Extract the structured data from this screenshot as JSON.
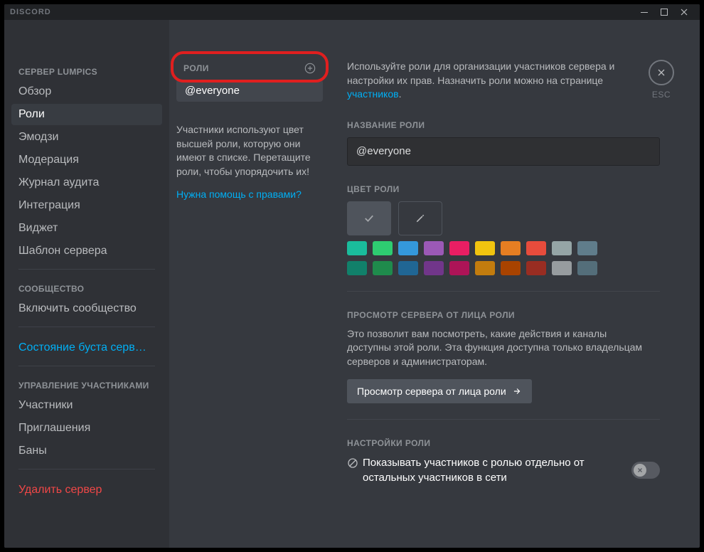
{
  "app": {
    "title": "DISCORD",
    "esc_label": "ESC"
  },
  "sidebar": {
    "server_header": "СЕРВЕР LUMPICS",
    "items": [
      "Обзор",
      "Роли",
      "Эмодзи",
      "Модерация",
      "Журнал аудита",
      "Интеграция",
      "Виджет",
      "Шаблон сервера"
    ],
    "community_header": "СООБЩЕСТВО",
    "community_items": [
      "Включить сообщество"
    ],
    "boost_item": "Состояние буста серв…",
    "user_mgmt_header": "УПРАВЛЕНИЕ УЧАСТНИКАМИ",
    "user_mgmt_items": [
      "Участники",
      "Приглашения",
      "Баны"
    ],
    "delete_server": "Удалить сервер"
  },
  "roles": {
    "header": "РОЛИ",
    "list": [
      "@everyone"
    ],
    "help_text": "Участники используют цвет высшей роли, которую они имеют в списке. Перетащите роли, чтобы упорядочить их!",
    "perm_help_link": "Нужна помощь с правами?"
  },
  "detail": {
    "desc_prefix": "Используйте роли для организации участников сервера и настройки их прав. Назначить роли можно на странице ",
    "desc_link": "участников",
    "name_label": "НАЗВАНИЕ РОЛИ",
    "name_value": "@everyone",
    "color_label": "ЦВЕТ РОЛИ",
    "swatches_row1": [
      "#1abc9c",
      "#2ecc71",
      "#3498db",
      "#9b59b6",
      "#e91e63",
      "#f1c40f",
      "#e67e22",
      "#e74c3c",
      "#95a5a6",
      "#607d8b"
    ],
    "swatches_row2": [
      "#11806a",
      "#1f8b4c",
      "#206694",
      "#71368a",
      "#ad1457",
      "#c27c0e",
      "#a84300",
      "#992d22",
      "#979c9f",
      "#546e7a"
    ],
    "preview_label": "ПРОСМОТР СЕРВЕРА ОТ ЛИЦА РОЛИ",
    "preview_desc": "Это позволит вам посмотреть, какие действия и каналы доступны этой роли. Эта функция доступна только владельцам серверов и администраторам.",
    "preview_button": "Просмотр сервера от лица роли",
    "settings_label": "НАСТРОЙКИ РОЛИ",
    "setting_display_separately": "Показывать участников с ролью отдельно от остальных участников в сети"
  }
}
